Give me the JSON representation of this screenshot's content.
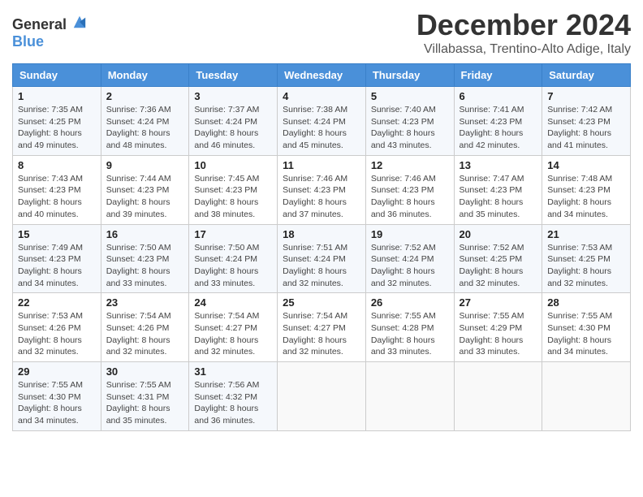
{
  "header": {
    "logo_line1": "General",
    "logo_line2": "Blue",
    "month_title": "December 2024",
    "location": "Villabassa, Trentino-Alto Adige, Italy"
  },
  "days_of_week": [
    "Sunday",
    "Monday",
    "Tuesday",
    "Wednesday",
    "Thursday",
    "Friday",
    "Saturday"
  ],
  "weeks": [
    [
      {
        "day": "1",
        "sunrise": "7:35 AM",
        "sunset": "4:25 PM",
        "daylight": "8 hours and 49 minutes."
      },
      {
        "day": "2",
        "sunrise": "7:36 AM",
        "sunset": "4:24 PM",
        "daylight": "8 hours and 48 minutes."
      },
      {
        "day": "3",
        "sunrise": "7:37 AM",
        "sunset": "4:24 PM",
        "daylight": "8 hours and 46 minutes."
      },
      {
        "day": "4",
        "sunrise": "7:38 AM",
        "sunset": "4:24 PM",
        "daylight": "8 hours and 45 minutes."
      },
      {
        "day": "5",
        "sunrise": "7:40 AM",
        "sunset": "4:23 PM",
        "daylight": "8 hours and 43 minutes."
      },
      {
        "day": "6",
        "sunrise": "7:41 AM",
        "sunset": "4:23 PM",
        "daylight": "8 hours and 42 minutes."
      },
      {
        "day": "7",
        "sunrise": "7:42 AM",
        "sunset": "4:23 PM",
        "daylight": "8 hours and 41 minutes."
      }
    ],
    [
      {
        "day": "8",
        "sunrise": "7:43 AM",
        "sunset": "4:23 PM",
        "daylight": "8 hours and 40 minutes."
      },
      {
        "day": "9",
        "sunrise": "7:44 AM",
        "sunset": "4:23 PM",
        "daylight": "8 hours and 39 minutes."
      },
      {
        "day": "10",
        "sunrise": "7:45 AM",
        "sunset": "4:23 PM",
        "daylight": "8 hours and 38 minutes."
      },
      {
        "day": "11",
        "sunrise": "7:46 AM",
        "sunset": "4:23 PM",
        "daylight": "8 hours and 37 minutes."
      },
      {
        "day": "12",
        "sunrise": "7:46 AM",
        "sunset": "4:23 PM",
        "daylight": "8 hours and 36 minutes."
      },
      {
        "day": "13",
        "sunrise": "7:47 AM",
        "sunset": "4:23 PM",
        "daylight": "8 hours and 35 minutes."
      },
      {
        "day": "14",
        "sunrise": "7:48 AM",
        "sunset": "4:23 PM",
        "daylight": "8 hours and 34 minutes."
      }
    ],
    [
      {
        "day": "15",
        "sunrise": "7:49 AM",
        "sunset": "4:23 PM",
        "daylight": "8 hours and 34 minutes."
      },
      {
        "day": "16",
        "sunrise": "7:50 AM",
        "sunset": "4:23 PM",
        "daylight": "8 hours and 33 minutes."
      },
      {
        "day": "17",
        "sunrise": "7:50 AM",
        "sunset": "4:24 PM",
        "daylight": "8 hours and 33 minutes."
      },
      {
        "day": "18",
        "sunrise": "7:51 AM",
        "sunset": "4:24 PM",
        "daylight": "8 hours and 32 minutes."
      },
      {
        "day": "19",
        "sunrise": "7:52 AM",
        "sunset": "4:24 PM",
        "daylight": "8 hours and 32 minutes."
      },
      {
        "day": "20",
        "sunrise": "7:52 AM",
        "sunset": "4:25 PM",
        "daylight": "8 hours and 32 minutes."
      },
      {
        "day": "21",
        "sunrise": "7:53 AM",
        "sunset": "4:25 PM",
        "daylight": "8 hours and 32 minutes."
      }
    ],
    [
      {
        "day": "22",
        "sunrise": "7:53 AM",
        "sunset": "4:26 PM",
        "daylight": "8 hours and 32 minutes."
      },
      {
        "day": "23",
        "sunrise": "7:54 AM",
        "sunset": "4:26 PM",
        "daylight": "8 hours and 32 minutes."
      },
      {
        "day": "24",
        "sunrise": "7:54 AM",
        "sunset": "4:27 PM",
        "daylight": "8 hours and 32 minutes."
      },
      {
        "day": "25",
        "sunrise": "7:54 AM",
        "sunset": "4:27 PM",
        "daylight": "8 hours and 32 minutes."
      },
      {
        "day": "26",
        "sunrise": "7:55 AM",
        "sunset": "4:28 PM",
        "daylight": "8 hours and 33 minutes."
      },
      {
        "day": "27",
        "sunrise": "7:55 AM",
        "sunset": "4:29 PM",
        "daylight": "8 hours and 33 minutes."
      },
      {
        "day": "28",
        "sunrise": "7:55 AM",
        "sunset": "4:30 PM",
        "daylight": "8 hours and 34 minutes."
      }
    ],
    [
      {
        "day": "29",
        "sunrise": "7:55 AM",
        "sunset": "4:30 PM",
        "daylight": "8 hours and 34 minutes."
      },
      {
        "day": "30",
        "sunrise": "7:55 AM",
        "sunset": "4:31 PM",
        "daylight": "8 hours and 35 minutes."
      },
      {
        "day": "31",
        "sunrise": "7:56 AM",
        "sunset": "4:32 PM",
        "daylight": "8 hours and 36 minutes."
      },
      null,
      null,
      null,
      null
    ]
  ],
  "labels": {
    "sunrise": "Sunrise:",
    "sunset": "Sunset:",
    "daylight": "Daylight:"
  }
}
